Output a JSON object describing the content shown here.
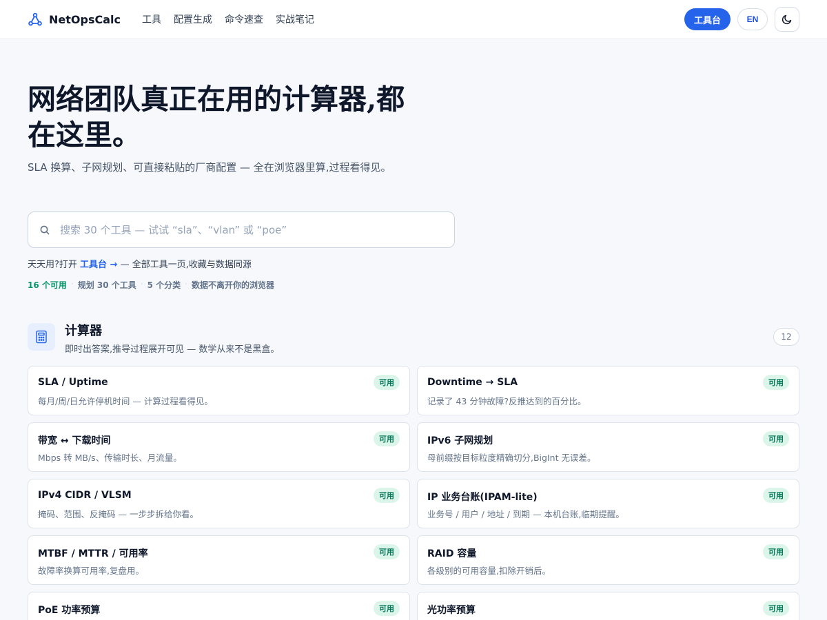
{
  "header": {
    "brand": "NetOpsCalc",
    "nav": [
      "工具",
      "配置生成",
      "命令速查",
      "实战笔记"
    ],
    "workbench_label": "工具台",
    "lang_label": "EN"
  },
  "hero": {
    "title": "网络团队真正在用的计算器,都在这里。",
    "subtitle": "SLA 换算、子网规划、可直接粘贴的厂商配置 — 全在浏览器里算,过程看得见。"
  },
  "search": {
    "placeholder": "搜索 30 个工具 — 试试 “sla”、“vlan” 或 “poe”"
  },
  "hint": {
    "prefix": "天天用?打开",
    "link": "工具台 →",
    "suffix": "— 全部工具一页,收藏与数据同源"
  },
  "stats": {
    "available": "16 个可用",
    "planned": "规划 30 个工具",
    "categories": "5 个分类",
    "privacy": "数据不离开你的浏览器"
  },
  "section": {
    "title": "计算器",
    "description": "即时出答案,推导过程展开可见 — 数学从来不是黑盒。",
    "count": "12"
  },
  "cards": [
    {
      "title": "SLA / Uptime",
      "desc": "每月/周/日允许停机时间 — 计算过程看得见。",
      "badge": "可用"
    },
    {
      "title": "Downtime → SLA",
      "desc": "记录了 43 分钟故障?反推达到的百分比。",
      "badge": "可用"
    },
    {
      "title": "带宽 ↔ 下载时间",
      "desc": "Mbps 转 MB/s、传输时长、月流量。",
      "badge": "可用"
    },
    {
      "title": "IPv6 子网规划",
      "desc": "母前缀按目标粒度精确切分,BigInt 无误差。",
      "badge": "可用"
    },
    {
      "title": "IPv4 CIDR / VLSM",
      "desc": "掩码、范围、反掩码 — 一步步拆给你看。",
      "badge": "可用"
    },
    {
      "title": "IP 业务台账(IPAM-lite)",
      "desc": "业务号 / 用户 / 地址 / 到期 — 本机台账,临期提醒。",
      "badge": "可用"
    },
    {
      "title": "MTBF / MTTR / 可用率",
      "desc": "故障率换算可用率,复盘用。",
      "badge": "可用"
    },
    {
      "title": "RAID 容量",
      "desc": "各级别的可用容量,扣除开销后。",
      "badge": "可用"
    },
    {
      "title": "PoE 功率预算",
      "desc": "",
      "badge": "可用"
    },
    {
      "title": "光功率预算",
      "desc": "",
      "badge": "可用"
    }
  ]
}
